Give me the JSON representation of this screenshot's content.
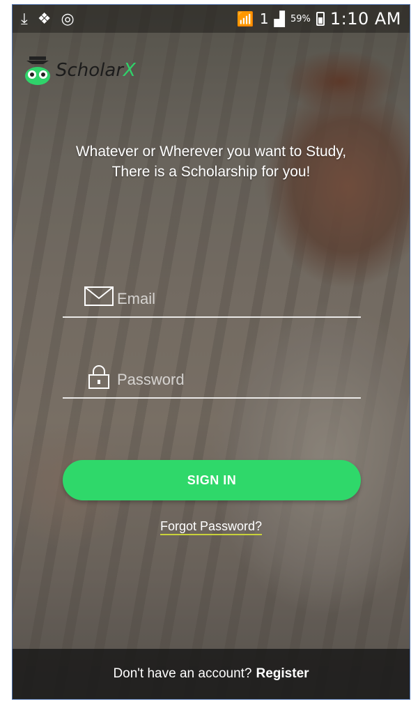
{
  "status_bar": {
    "left_icons": [
      "download-icon",
      "dropbox-icon",
      "instagram-icon"
    ],
    "sim_label": "1",
    "battery_percent": "59%",
    "time": "1:10 AM"
  },
  "app": {
    "logo_text_main": "Scholar",
    "logo_text_accent": "X",
    "tagline_line1": "Whatever or Wherever you want to Study,",
    "tagline_line2": "There is a Scholarship for you!"
  },
  "form": {
    "email_placeholder": "Email",
    "password_placeholder": "Password",
    "signin_label": "SIGN IN",
    "forgot_label": "Forgot Password?"
  },
  "footer": {
    "prompt": "Don't have an account?",
    "register_label": "Register"
  },
  "colors": {
    "accent_green": "#2fd86a",
    "underline_yellow": "#c9d23a"
  }
}
